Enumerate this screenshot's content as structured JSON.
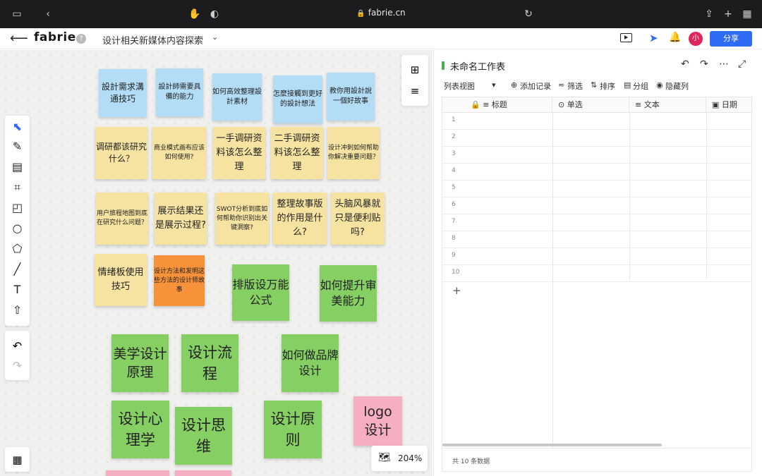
{
  "browser": {
    "url": "fabrie.cn",
    "icons": [
      "sidebar-icon",
      "back-icon",
      "hand-icon",
      "shield-icon",
      "lock-icon",
      "reload-icon",
      "share-icon",
      "new-tab-icon",
      "tabs-grid-icon"
    ]
  },
  "header": {
    "logo": "fabrie",
    "help": "?",
    "title": "设计相关新媒体内容探索",
    "avatar": "小",
    "share_label": "分享"
  },
  "canvas": {
    "zoom": "204%",
    "tools": [
      "select-icon",
      "pen-icon",
      "frame-icon",
      "crop-icon",
      "sticky-note-icon",
      "circle-icon",
      "pentagon-icon",
      "line-icon",
      "text-icon",
      "upload-icon"
    ],
    "stickies": [
      {
        "text": "設計需求溝通技巧",
        "color": "blue"
      },
      {
        "text": "設計師需要具備的能力",
        "color": "blue"
      },
      {
        "text": "如何高效整理設計素材",
        "color": "blue"
      },
      {
        "text": "怎麼接觸到更好的設計想法",
        "color": "blue"
      },
      {
        "text": "教你用設計說一個好故事",
        "color": "blue"
      },
      {
        "text": "调研都该研究什么？",
        "color": "yellow"
      },
      {
        "text": "商业模式画布应该如何使用?",
        "color": "yellow"
      },
      {
        "text": "一手调研资料该怎么整理",
        "color": "yellow"
      },
      {
        "text": "二手调研资料该怎么整理",
        "color": "yellow"
      },
      {
        "text": "设计冲刺如何帮助你解决重要问题？",
        "color": "yellow"
      },
      {
        "text": "用户旅程地图到底在研究什么问题？",
        "color": "yellow"
      },
      {
        "text": "展示结果还是展示过程?",
        "color": "yellow"
      },
      {
        "text": "SWOT分析到底如何帮助你识别出关键洞察?",
        "color": "yellow"
      },
      {
        "text": "整理故事版的作用是什么?",
        "color": "yellow"
      },
      {
        "text": "头脑风暴就只是便利贴吗?",
        "color": "yellow"
      },
      {
        "text": "情绪板使用技巧",
        "color": "yellow"
      },
      {
        "text": "设计方法和发明这些方法的设计师故事",
        "color": "orange"
      },
      {
        "text": "排版设万能公式",
        "color": "green"
      },
      {
        "text": "如何提升审美能力",
        "color": "green"
      },
      {
        "text": "美学设计原理",
        "color": "green"
      },
      {
        "text": "设计流程",
        "color": "green"
      },
      {
        "text": "如何做品牌设计",
        "color": "green"
      },
      {
        "text": "设计心理学",
        "color": "green"
      },
      {
        "text": "设计思维",
        "color": "green"
      },
      {
        "text": "设计原则",
        "color": "green"
      },
      {
        "text": "logo设计",
        "color": "pink"
      }
    ]
  },
  "panel": {
    "title": "未命名工作表",
    "view": "列表视图",
    "toolbar": {
      "add": "添加记录",
      "filter": "筛选",
      "sort": "排序",
      "group": "分组",
      "hide": "隐藏列"
    },
    "columns": [
      "标题",
      "单选",
      "文本",
      "日期"
    ],
    "rows": [
      "1",
      "2",
      "3",
      "4",
      "5",
      "6",
      "7",
      "8",
      "9",
      "10"
    ],
    "footer": "共 10 条数据"
  },
  "colors": {
    "accent": "#2f6cf5",
    "blue_note": "#b3ddf6",
    "yellow_note": "#f6e3a1",
    "orange_note": "#f7923a",
    "green_note": "#86cf63",
    "pink_note": "#f6aec3"
  }
}
